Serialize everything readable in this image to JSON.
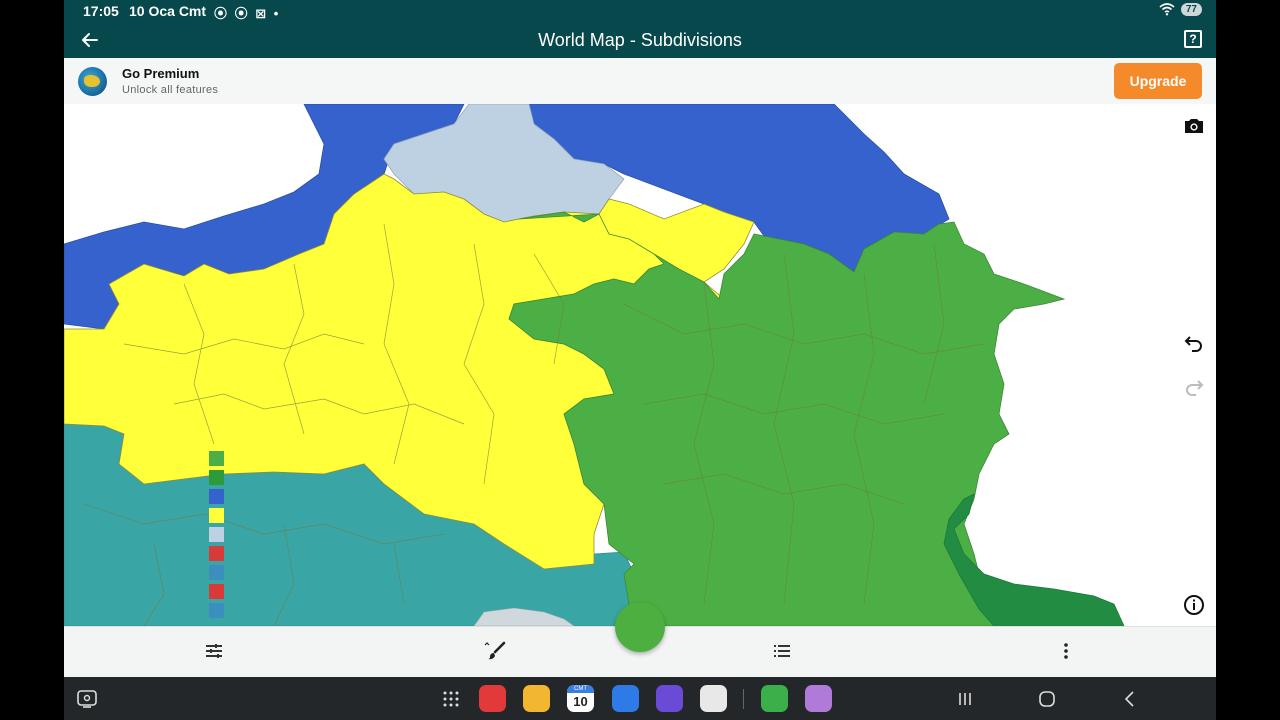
{
  "status_bar": {
    "time": "17:05",
    "date": "10 Oca Cmt",
    "notification_icons": "⦿ ⦿ ⊠ •",
    "battery": "77"
  },
  "app_bar": {
    "title": "World Map - Subdivisions",
    "back_icon": "arrow-left-icon",
    "help_icon": "question-box-icon",
    "help_glyph": "?"
  },
  "premium": {
    "title": "Go Premium",
    "subtitle": "Unlock all features",
    "button_label": "Upgrade",
    "button_color": "#f58a2b"
  },
  "map": {
    "region_colors": {
      "blue": "#3562cc",
      "light_blue": "#bdd1e3",
      "yellow": "#ffff3a",
      "green": "#4caf45",
      "dark_green": "#228c43",
      "teal": "#3aa5a5",
      "border": "#7a7a4a"
    },
    "side_icons": [
      "camera-icon",
      "undo-icon",
      "redo-icon",
      "info-icon"
    ]
  },
  "legend": {
    "colors": [
      "#4caf45",
      "#2f9a3c",
      "#3562cc",
      "#ffff3a",
      "#bdd1e3",
      "#d83a3a",
      "#3a8fbf",
      "#d83a3a",
      "#3a8fbf"
    ]
  },
  "toolbar": {
    "icons": [
      "sliders-icon",
      "brush-icon",
      "list-icon",
      "more-vert-icon"
    ],
    "fab_color": "#4caf3f"
  },
  "nav_bar": {
    "calendar_day": "10",
    "calendar_month": "CMT"
  }
}
